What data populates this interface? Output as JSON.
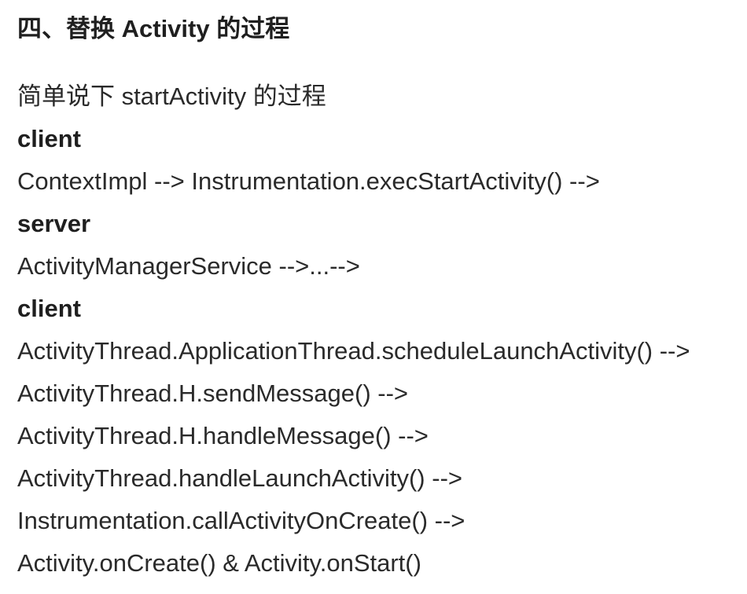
{
  "section": {
    "heading": "四、替换 Activity 的过程",
    "intro": "简单说下 startActivity 的过程",
    "steps": [
      {
        "label": "client",
        "bold": true
      },
      {
        "label": "ContextImpl --> Instrumentation.execStartActivity() -->",
        "bold": false
      },
      {
        "label": "server",
        "bold": true
      },
      {
        "label": "ActivityManagerService -->...-->",
        "bold": false
      },
      {
        "label": "client",
        "bold": true
      },
      {
        "label": "ActivityThread.ApplicationThread.scheduleLaunchActivity() -->",
        "bold": false
      },
      {
        "label": "ActivityThread.H.sendMessage() -->",
        "bold": false
      },
      {
        "label": "ActivityThread.H.handleMessage() -->",
        "bold": false
      },
      {
        "label": "ActivityThread.handleLaunchActivity() -->",
        "bold": false
      },
      {
        "label": "Instrumentation.callActivityOnCreate() -->",
        "bold": false
      },
      {
        "label": "Activity.onCreate() & Activity.onStart()",
        "bold": false
      }
    ]
  }
}
